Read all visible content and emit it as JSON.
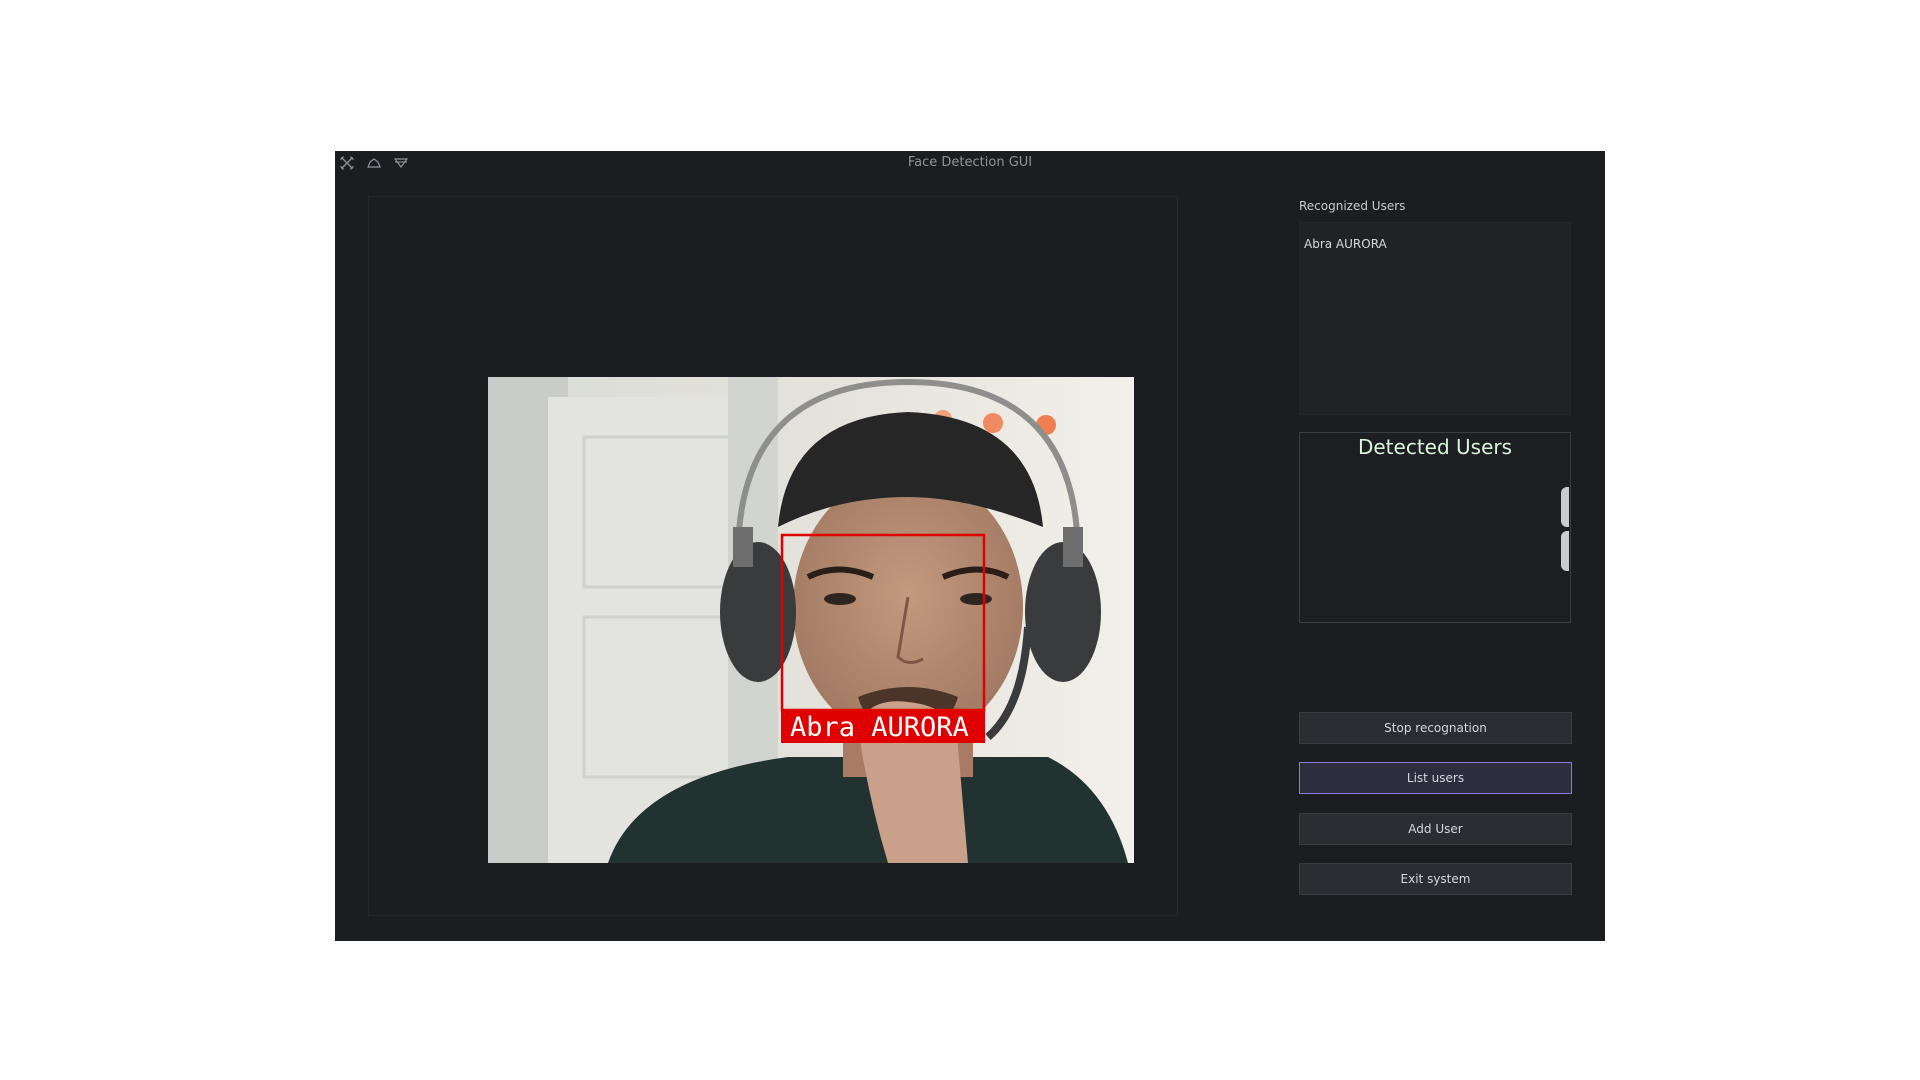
{
  "window": {
    "title": "Face Detection GUI",
    "titlebar_icons": [
      "close-icon",
      "minimize-icon",
      "maximize-icon"
    ]
  },
  "camera": {
    "face_label": "Abra AURORA",
    "box_color": "#e00000"
  },
  "recognized": {
    "label": "Recognized Users",
    "items": [
      "Abra AURORA"
    ]
  },
  "detected": {
    "title": "Detected Users"
  },
  "buttons": {
    "stop": "Stop recognation",
    "list": "List users",
    "add": "Add User",
    "exit": "Exit system"
  },
  "colors": {
    "window_bg": "#1b1d21",
    "accent_focus": "#8e7ad6",
    "detected_title": "#d9f5dc"
  }
}
